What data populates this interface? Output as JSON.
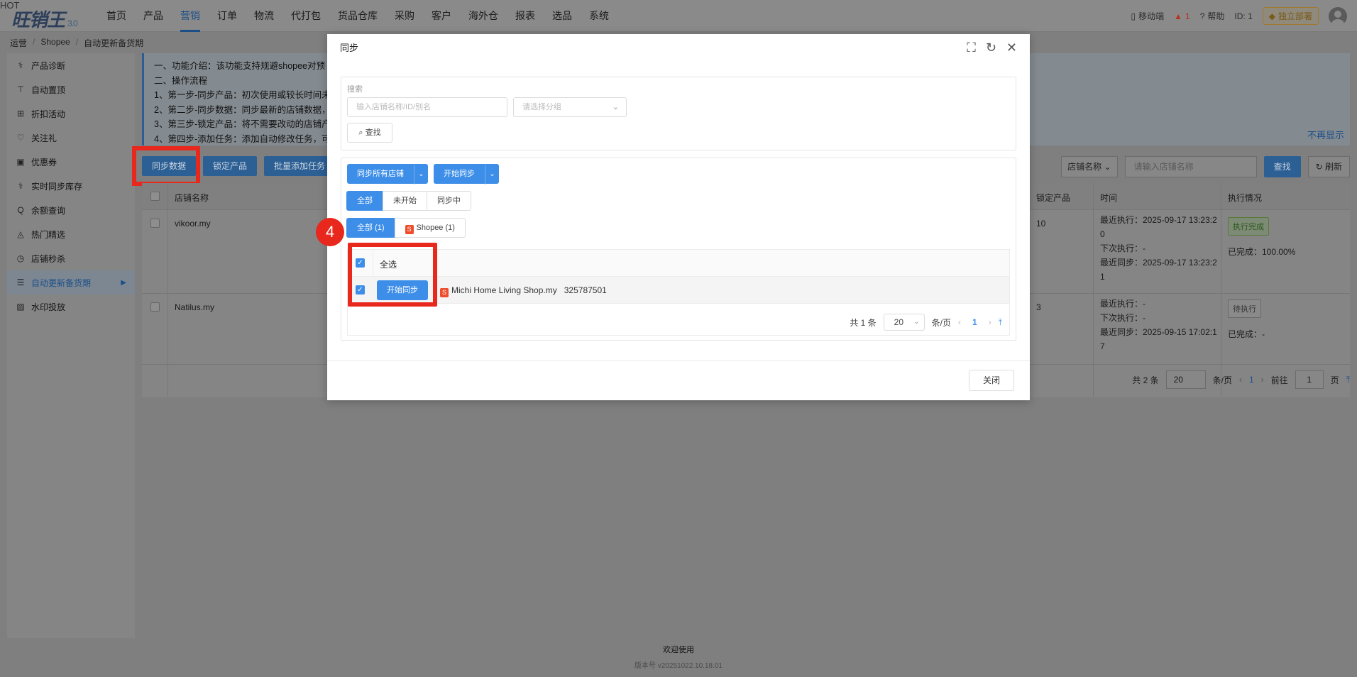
{
  "header": {
    "logo": "旺销王",
    "logo_version": "3.0",
    "nav": [
      "首页",
      "产品",
      "营销",
      "订单",
      "物流",
      "代打包",
      "货品仓库",
      "采购",
      "客户",
      "海外仓",
      "报表",
      "选品",
      "系统"
    ],
    "active_nav": "营销",
    "mobile": "移动端",
    "hot": "HOT",
    "alerts": "1",
    "help": "帮助",
    "id_text": "ID: 1",
    "deploy": "独立部署"
  },
  "breadcrumb": [
    "运营",
    "Shopee",
    "自动更新备货期"
  ],
  "sidebar": {
    "items": [
      {
        "label": "产品诊断",
        "icon": "stethoscope-icon",
        "glyph": "⚕"
      },
      {
        "label": "自动置顶",
        "icon": "pin-top-icon",
        "glyph": "⊤"
      },
      {
        "label": "折扣活动",
        "icon": "gift-icon",
        "glyph": "⊞"
      },
      {
        "label": "关注礼",
        "icon": "heart-icon",
        "glyph": "♡"
      },
      {
        "label": "优惠券",
        "icon": "coupon-icon",
        "glyph": "▣"
      },
      {
        "label": "实时同步库存",
        "icon": "sync-icon",
        "glyph": "⚕"
      },
      {
        "label": "余额查询",
        "icon": "balance-icon",
        "glyph": "Q"
      },
      {
        "label": "热门精选",
        "icon": "fire-icon",
        "glyph": "◬"
      },
      {
        "label": "店铺秒杀",
        "icon": "clock-icon",
        "glyph": "◷"
      },
      {
        "label": "自动更新备货期",
        "icon": "list-icon",
        "glyph": "☰"
      },
      {
        "label": "水印投放",
        "icon": "image-icon",
        "glyph": "▨"
      }
    ],
    "active": "自动更新备货期"
  },
  "info": {
    "lines": [
      "一、功能介绍：该功能支持规避shopee对预",
      "二、操作流程",
      "1、第一步-同步产品：初次使用或较长时间未",
      "2、第二步-同步数据：同步最新的店铺数据，",
      "3、第三步-锁定产品：将不需要改动的店铺产",
      "4、第四步-添加任务：添加自动修改任务，可"
    ],
    "dismiss": "不再显示"
  },
  "toolbar": {
    "sync_data": "同步数据",
    "lock_products": "锁定产品",
    "batch_add_task": "批量添加任务",
    "shop_name_select": "店铺名称",
    "shop_name_placeholder": "请输入店铺名称",
    "search": "查找",
    "refresh": "刷新"
  },
  "table": {
    "headers": {
      "shop_name": "店铺名称",
      "locked": "锁定产品",
      "time": "时间",
      "status": "执行情况"
    },
    "rows": [
      {
        "shop": "vikoor.my",
        "locked": "10",
        "time": [
          "最近执行：2025-09-17 13:23:2",
          "0",
          "下次执行：-",
          "最近同步：2025-09-17 13:23:2",
          "1"
        ],
        "status_tag": "执行完成",
        "completion": "已完成：100.00%"
      },
      {
        "shop": "Natilus.my",
        "locked": "3",
        "time": [
          "最近执行：-",
          "下次执行：-",
          "最近同步：2025-09-15 17:02:1",
          "7"
        ],
        "status_tag": "待执行",
        "completion": "已完成：-"
      }
    ],
    "pager": {
      "total": "共 2 条",
      "size": "20",
      "per_page": "条/页",
      "page": "1",
      "goto": "前往",
      "goto_value": "1",
      "page_unit": "页"
    }
  },
  "footer": {
    "welcome": "欢迎使用",
    "version": "版本号 v20251022.10.18.01"
  },
  "modal": {
    "title": "同步",
    "search_label": "搜索",
    "search_placeholder": "输入店铺名称/ID/别名",
    "group_placeholder": "请选择分组",
    "find": "查找",
    "sync_all_shops": "同步所有店铺",
    "start_sync": "开始同步",
    "status_tabs": [
      "全部",
      "未开始",
      "同步中"
    ],
    "platform_tabs": {
      "all": "全部 (1)",
      "shopee": "Shopee (1)"
    },
    "select_all": "全选",
    "row": {
      "start_sync": "开始同步",
      "shop": "Michi Home Living Shop.my",
      "shop_id": "325787501"
    },
    "pager": {
      "total": "共 1 条",
      "size": "20",
      "per_page": "条/页",
      "page": "1"
    },
    "close": "关闭"
  },
  "annotation": {
    "step": "4"
  }
}
